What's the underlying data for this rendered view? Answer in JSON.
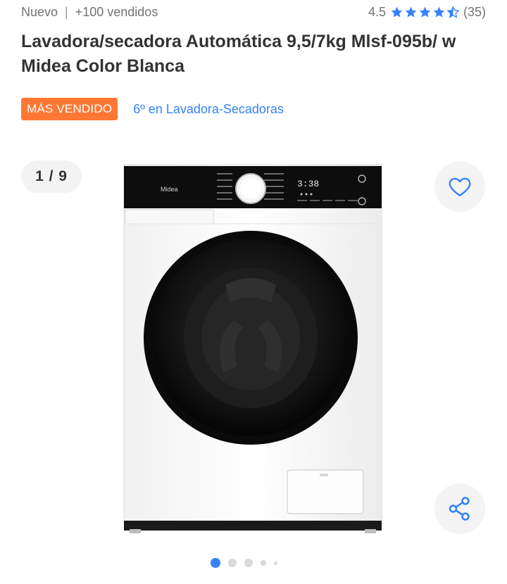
{
  "header": {
    "condition": "Nuevo",
    "separator": "|",
    "sold": "+100 vendidos",
    "rating_value": "4.5",
    "rating_stars": 4.5,
    "review_count": "(35)"
  },
  "product": {
    "title": "Lavadora/secadora Automática 9,5/7kg Mlsf-095b/ w Midea Color Blanca",
    "badge_label": "MÁS VENDIDO",
    "rank_label": "6º en Lavadora-Secadoras"
  },
  "gallery": {
    "counter": "1 / 9",
    "image_brand": "Midea",
    "display_time": "3:38",
    "total_images": 9,
    "current_index": 1
  },
  "icons": {
    "favorite": "heart-icon",
    "share": "share-icon",
    "star": "star-icon"
  },
  "colors": {
    "accent": "#3483fa",
    "badge": "#ff7733",
    "text": "#333333",
    "muted": "#737373"
  }
}
